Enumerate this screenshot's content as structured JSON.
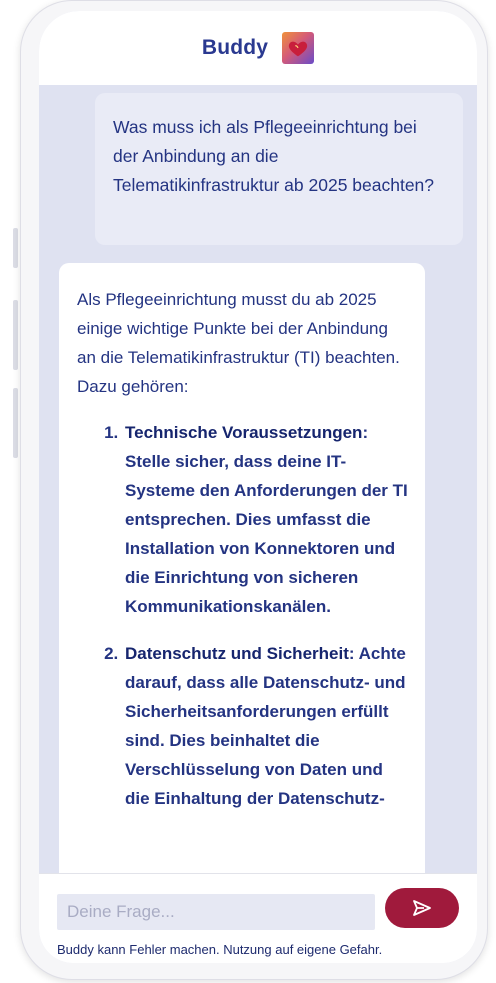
{
  "header": {
    "title": "Buddy",
    "logo_icon": "heart-logo-icon"
  },
  "conversation": {
    "user_message": "Was muss ich als Pflegeeinrichtung bei der Anbindung an die Telematikinfrastruktur ab 2025 beachten?",
    "bot_message": {
      "intro": "Als Pflegeeinrichtung musst du ab 2025 einige wichtige Punkte bei der Anbindung an die Telematikinfrastruktur (TI) beachten. Dazu gehören:",
      "items": [
        {
          "title": "Technische Voraussetzungen",
          "text": "Stelle sicher, dass deine IT-Systeme den Anforderungen der TI entsprechen. Dies umfasst die Installation von Konnektoren und die Einrichtung von sicheren Kommunikationskanälen."
        },
        {
          "title": "Datenschutz und Sicherheit",
          "text": "Achte darauf, dass alle Datenschutz- und Sicherheitsanforderungen erfüllt sind. Dies beinhaltet die Verschlüsselung von Daten und die Einhaltung der Datenschutz-"
        }
      ]
    }
  },
  "input": {
    "placeholder": "Deine Frage...",
    "value": ""
  },
  "send_button": {
    "icon": "send-icon"
  },
  "disclaimer": "Buddy kann Fehler machen. Nutzung auf eigene Gefahr.",
  "colors": {
    "accent": "#a01a3c",
    "title": "#2a3990",
    "text": "#243482",
    "chat_background": "#dfe2f1",
    "user_bubble": "#e9ebf6"
  }
}
